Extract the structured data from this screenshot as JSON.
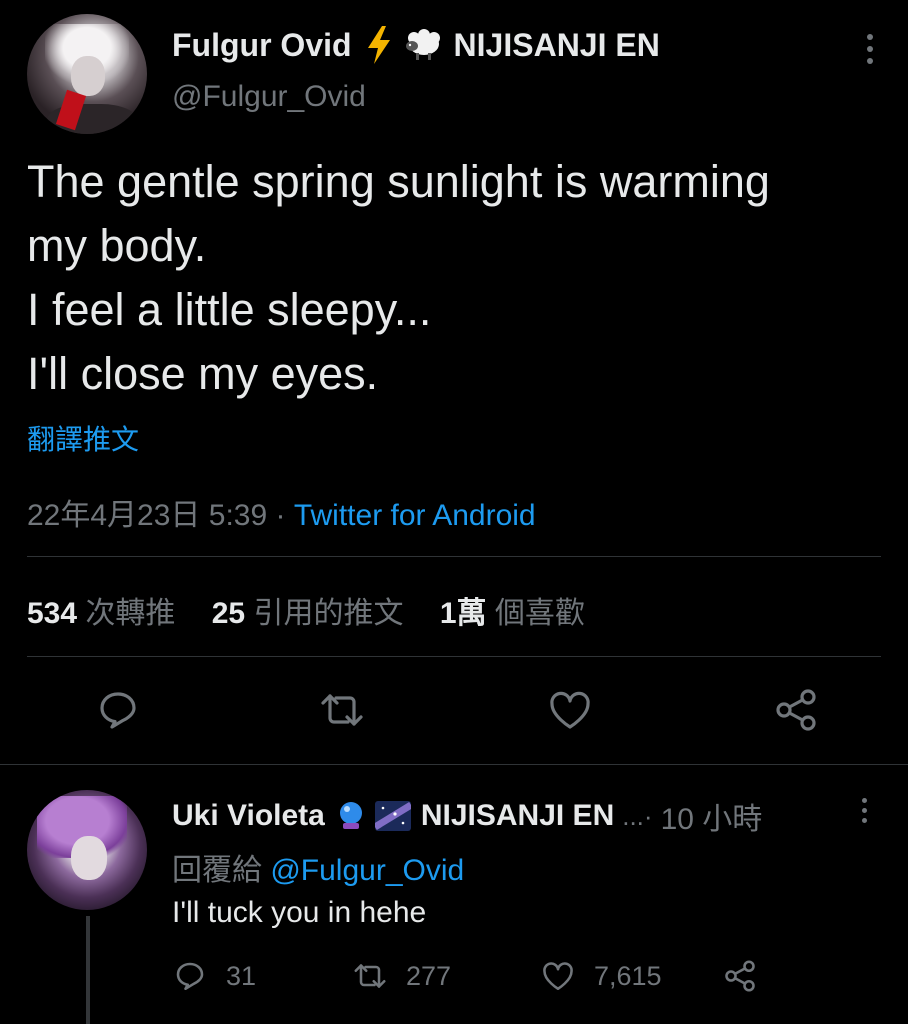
{
  "tweet": {
    "author_name": "Fulgur Ovid",
    "author_emojis": [
      "lightning-icon",
      "sheep-icon"
    ],
    "affiliation": "NIJISANJI EN",
    "handle": "@Fulgur_Ovid",
    "text_lines": [
      "The gentle spring sunlight is warming",
      "my body.",
      "I feel a little sleepy...",
      "I'll close my eyes."
    ],
    "translate_label": "翻譯推文",
    "timestamp": "22年4月23日 5:39",
    "separator": "·",
    "client": "Twitter for Android",
    "stats": {
      "retweets_count": "534",
      "retweets_label": "次轉推",
      "quotes_count": "25",
      "quotes_label": "引用的推文",
      "likes_count": "1萬",
      "likes_label": "個喜歡"
    },
    "actions": [
      "reply-icon",
      "retweet-icon",
      "like-icon",
      "share-icon"
    ]
  },
  "reply": {
    "author_name": "Uki Violeta",
    "author_emojis": [
      "crystal-ball-icon",
      "milky-way-icon"
    ],
    "affiliation": "NIJISANJI EN",
    "ellipsis": "...·",
    "time": "10 小時",
    "reply_to_label": "回覆給",
    "reply_to_handle": "@Fulgur_Ovid",
    "text": "I'll tuck you in hehe",
    "reply_count": "31",
    "retweet_count": "277",
    "like_count": "7,615"
  },
  "colors": {
    "background": "#000000",
    "text": "#e7e9ea",
    "secondary": "#71767b",
    "accent": "#1d9bf0",
    "divider": "#2f3336"
  }
}
